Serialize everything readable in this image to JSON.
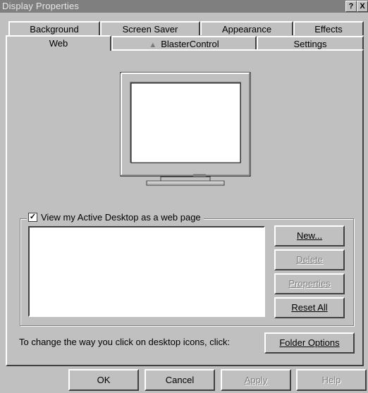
{
  "window": {
    "title": "Display Properties",
    "help_button": "?",
    "close_button": "X"
  },
  "tabs_row1": [
    {
      "label": "Background"
    },
    {
      "label": "Screen Saver"
    },
    {
      "label": "Appearance"
    },
    {
      "label": "Effects"
    }
  ],
  "tabs_row2": [
    {
      "label": "Web",
      "active": true
    },
    {
      "label": "BlasterControl",
      "icon": "blaster-icon"
    },
    {
      "label": "Settings"
    }
  ],
  "web": {
    "checkbox_label": "View my Active Desktop as a web page",
    "checkbox_checked": true,
    "checkbox_mark": "✓",
    "buttons": {
      "new": "New...",
      "delete": "Delete",
      "properties": "Properties",
      "reset_all": "Reset All",
      "folder_options": "Folder Options"
    },
    "hint": "To change the way you click on desktop icons, click:"
  },
  "footer": {
    "ok": "OK",
    "cancel": "Cancel",
    "apply": "Apply",
    "help": "Help"
  }
}
